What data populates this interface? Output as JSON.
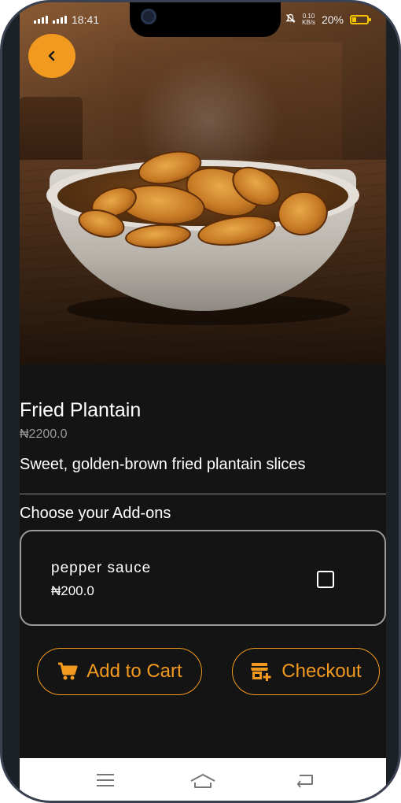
{
  "status_bar": {
    "time": "18:41",
    "network_speed_value": "0.10",
    "network_speed_unit": "KB/s",
    "battery": "20%"
  },
  "product": {
    "title": "Fried Plantain",
    "price": "₦2200.0",
    "description": "Sweet, golden-brown fried plantain slices"
  },
  "addons": {
    "heading": "Choose your Add-ons",
    "items": [
      {
        "name": "pepper sauce",
        "price": "₦200.0",
        "checked": false
      }
    ]
  },
  "actions": {
    "add_to_cart_label": "Add to Cart",
    "checkout_label": "Checkout"
  },
  "colors": {
    "accent": "#f29a1f",
    "background": "#141414"
  },
  "icons": [
    "back-arrow-icon",
    "cart-icon",
    "store-add-icon",
    "menu-icon",
    "home-icon",
    "back-nav-icon"
  ]
}
